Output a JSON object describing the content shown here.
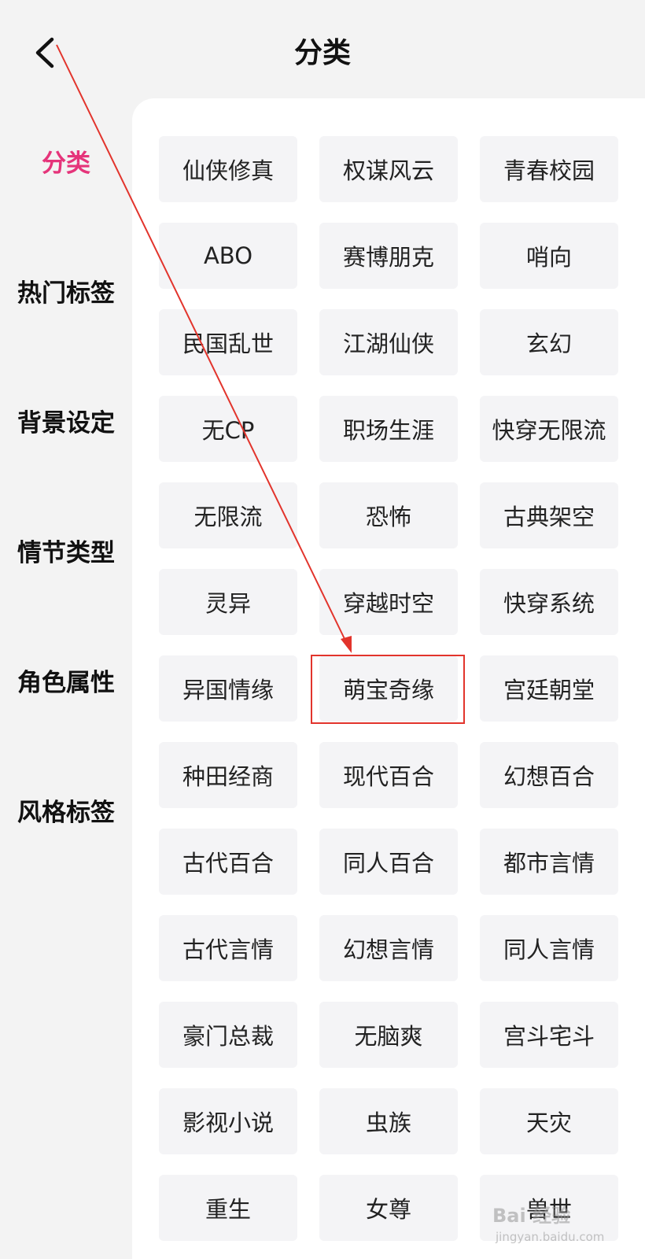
{
  "header": {
    "title": "分类"
  },
  "sidebar": {
    "items": [
      {
        "label": "分类"
      },
      {
        "label": "热门标签"
      },
      {
        "label": "背景设定"
      },
      {
        "label": "情节类型"
      },
      {
        "label": "角色属性"
      },
      {
        "label": "风格标签"
      }
    ]
  },
  "tags": [
    "仙侠修真",
    "权谋风云",
    "青春校园",
    "ABO",
    "赛博朋克",
    "哨向",
    "民国乱世",
    "江湖仙侠",
    "玄幻",
    "无CP",
    "职场生涯",
    "快穿无限流",
    "无限流",
    "恐怖",
    "古典架空",
    "灵异",
    "穿越时空",
    "快穿系统",
    "异国情缘",
    "萌宝奇缘",
    "宫廷朝堂",
    "种田经商",
    "现代百合",
    "幻想百合",
    "古代百合",
    "同人百合",
    "都市言情",
    "古代言情",
    "幻想言情",
    "同人言情",
    "豪门总裁",
    "无脑爽",
    "宫斗宅斗",
    "影视小说",
    "虫族",
    "天灾",
    "重生",
    "女尊",
    "兽世"
  ],
  "watermark": {
    "text": "Bai 经验",
    "sub": "jingyan.baidu.com"
  },
  "colors": {
    "accent": "#e5347a",
    "annotation": "#e2342c"
  }
}
